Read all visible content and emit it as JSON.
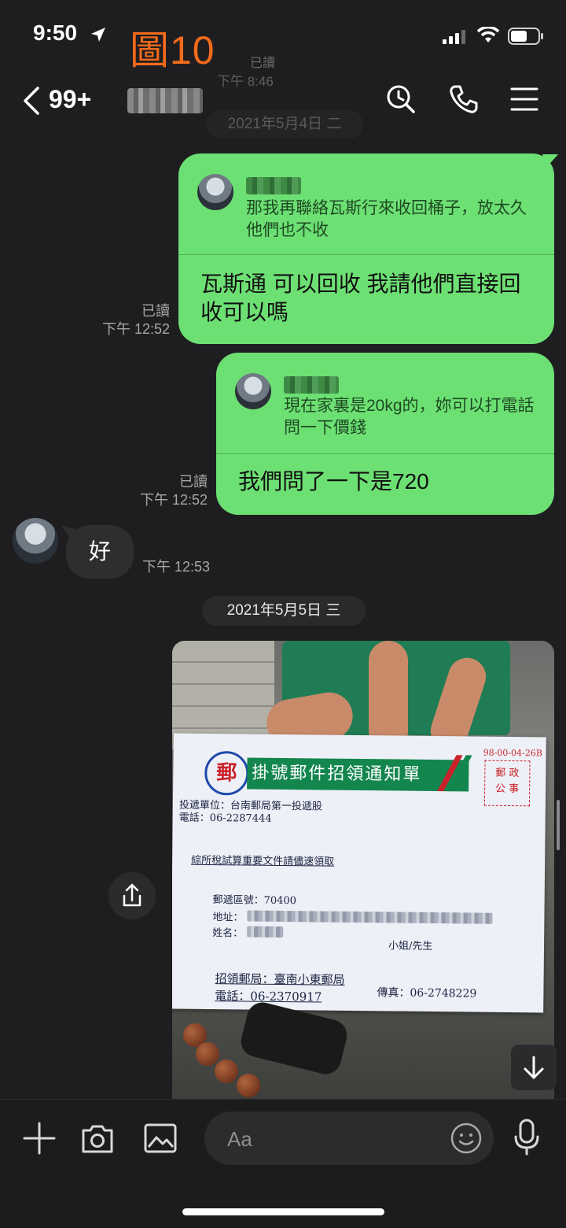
{
  "status_bar": {
    "time": "9:50",
    "figure_label": "圖10"
  },
  "background_faded": {
    "read": "已讀",
    "time": "下午 8:46",
    "date": "2021年5月4日 二"
  },
  "header": {
    "back_count": "99+"
  },
  "messages": [
    {
      "quote_text": "那我再聯絡瓦斯行來收回桶子，放太久他們也不收",
      "text": "瓦斯通 可以回收 我請他們直接回收可以嗎",
      "read": "已讀",
      "time": "下午 12:52"
    },
    {
      "quote_text": "現在家裏是20kg的，妳可以打電話問一下價錢",
      "text": "我們問了一下是720",
      "read": "已讀",
      "time": "下午 12:52"
    },
    {
      "text": "好",
      "time": "下午 12:53"
    }
  ],
  "date_separator": "2021年5月5日 三",
  "photo": {
    "notice_title": "掛號郵件招領通知單",
    "logo_char": "郵",
    "code": "98-00-04-26B",
    "stamp": "郵 政\n公 事",
    "line1": "投遞單位：台南郵局第一投遞股",
    "line2": "電話：06-2287444",
    "headline": "綜所稅試算重要文件請儘速領取",
    "zip": "郵遞區號：70400",
    "addr_label": "地址：",
    "name_label": "姓名：",
    "salutation": "小姐/先生",
    "pickup": "招領郵局：臺南小東郵局",
    "phone": "電話：06-2370917",
    "fax": "傳真：06-2748229"
  },
  "composer": {
    "placeholder": "Aa"
  },
  "colors": {
    "outgoing": "#6de074",
    "accent_label": "#f26a1b",
    "background": "#1e1e20"
  }
}
